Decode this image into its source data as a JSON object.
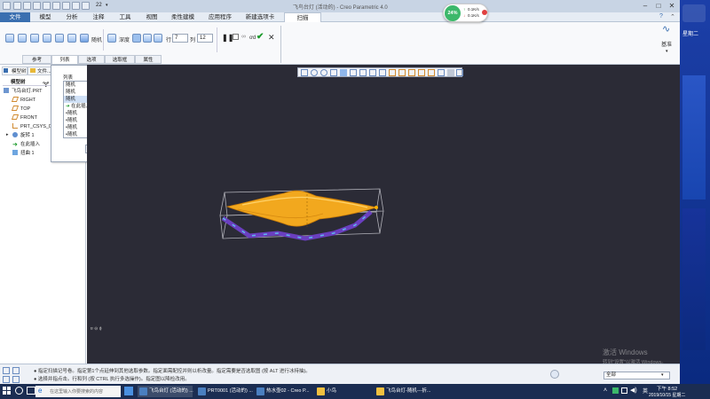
{
  "window": {
    "title": "飞鸟台灯 (活动的) - Creo Parametric 4.0",
    "qat_number": "22"
  },
  "menu": {
    "tabs": [
      "文件",
      "模型",
      "分析",
      "注释",
      "工具",
      "视图",
      "柔性建模",
      "应用程序",
      "新建选项卡",
      "扫描"
    ]
  },
  "ribbon": {
    "depth_label": "深度",
    "row_label": "行",
    "row_value": "7",
    "col_label": "列",
    "col_value": "12",
    "dd_label": "ơd",
    "cut_label": "随机",
    "base_label": "基准",
    "subtabs": [
      "参考",
      "列表",
      "选项",
      "选取框",
      "属性"
    ]
  },
  "panel": {
    "tabs": [
      "模型树",
      "文件..."
    ],
    "header": "模型树",
    "items": [
      {
        "label": "飞鸟台灯.PRT",
        "icon": "part-icon"
      },
      {
        "label": "RIGHT",
        "icon": "plane-icon"
      },
      {
        "label": "TOP",
        "icon": "plane-icon"
      },
      {
        "label": "FRONT",
        "icon": "plane-icon"
      },
      {
        "label": "PRT_CSYS_DEF",
        "icon": "csys-icon"
      },
      {
        "label": "旋转 1",
        "icon": "revolve-icon"
      },
      {
        "label": "在此插入",
        "icon": "insert-arrow-icon"
      },
      {
        "label": "扭曲 1",
        "icon": "warp-icon"
      }
    ]
  },
  "list_dialog": {
    "title": "列表",
    "rows": [
      "随机",
      "随机",
      "随机",
      "在此插入",
      "随机",
      "随机",
      "随机",
      "随机",
      "随机"
    ],
    "selected_index": 2
  },
  "viewport": {
    "corner_label": "ɐ ⊖ ɸ"
  },
  "status": {
    "line1": "● 指定扫描记号卷。指定第1个点延伸到其他选取参数。指定面需配控并则以析改量。指定需要是否选取图 (按 ALT 进行冰持抽)。",
    "line2": "● 选择并指点击。行和列 (按 CTRL 执行多选操作)。指定图以降检改用。",
    "filter_value": "全部",
    "mode_value": "ɐ"
  },
  "netwidget": {
    "percent": "24%",
    "up": "0.1K/s",
    "down": "0.1K/s"
  },
  "watermark": {
    "line1": "激活 Windows",
    "line2": "转到\"设置\"以激活 Windows。"
  },
  "desktop": {
    "date_label": "星期二",
    "label2": "基准"
  },
  "taskbar": {
    "search_placeholder": "在这里输入你要搜索的内容",
    "items": [
      {
        "label": "飞鸟台灯 (活动的) ...",
        "color": "#4a7fc0"
      },
      {
        "label": "PRT0001 (活动的) ...",
        "color": "#4a7fc0"
      },
      {
        "label": "热水壶02 - Creo P...",
        "color": "#4a7fc0"
      },
      {
        "label": "小鸟",
        "color": "#f0c040"
      },
      {
        "label": "飞鸟台灯-随机---折...",
        "color": "#f0c040"
      }
    ],
    "ime": "英",
    "time": "下午 8:52",
    "date": "2019/10/15 星期二"
  },
  "colors": {
    "accent": "#3a6fb0",
    "viewport_bg": "#2b2b36",
    "model_yellow": "#f2a81e",
    "sketch_purple": "#6a3fc0"
  }
}
